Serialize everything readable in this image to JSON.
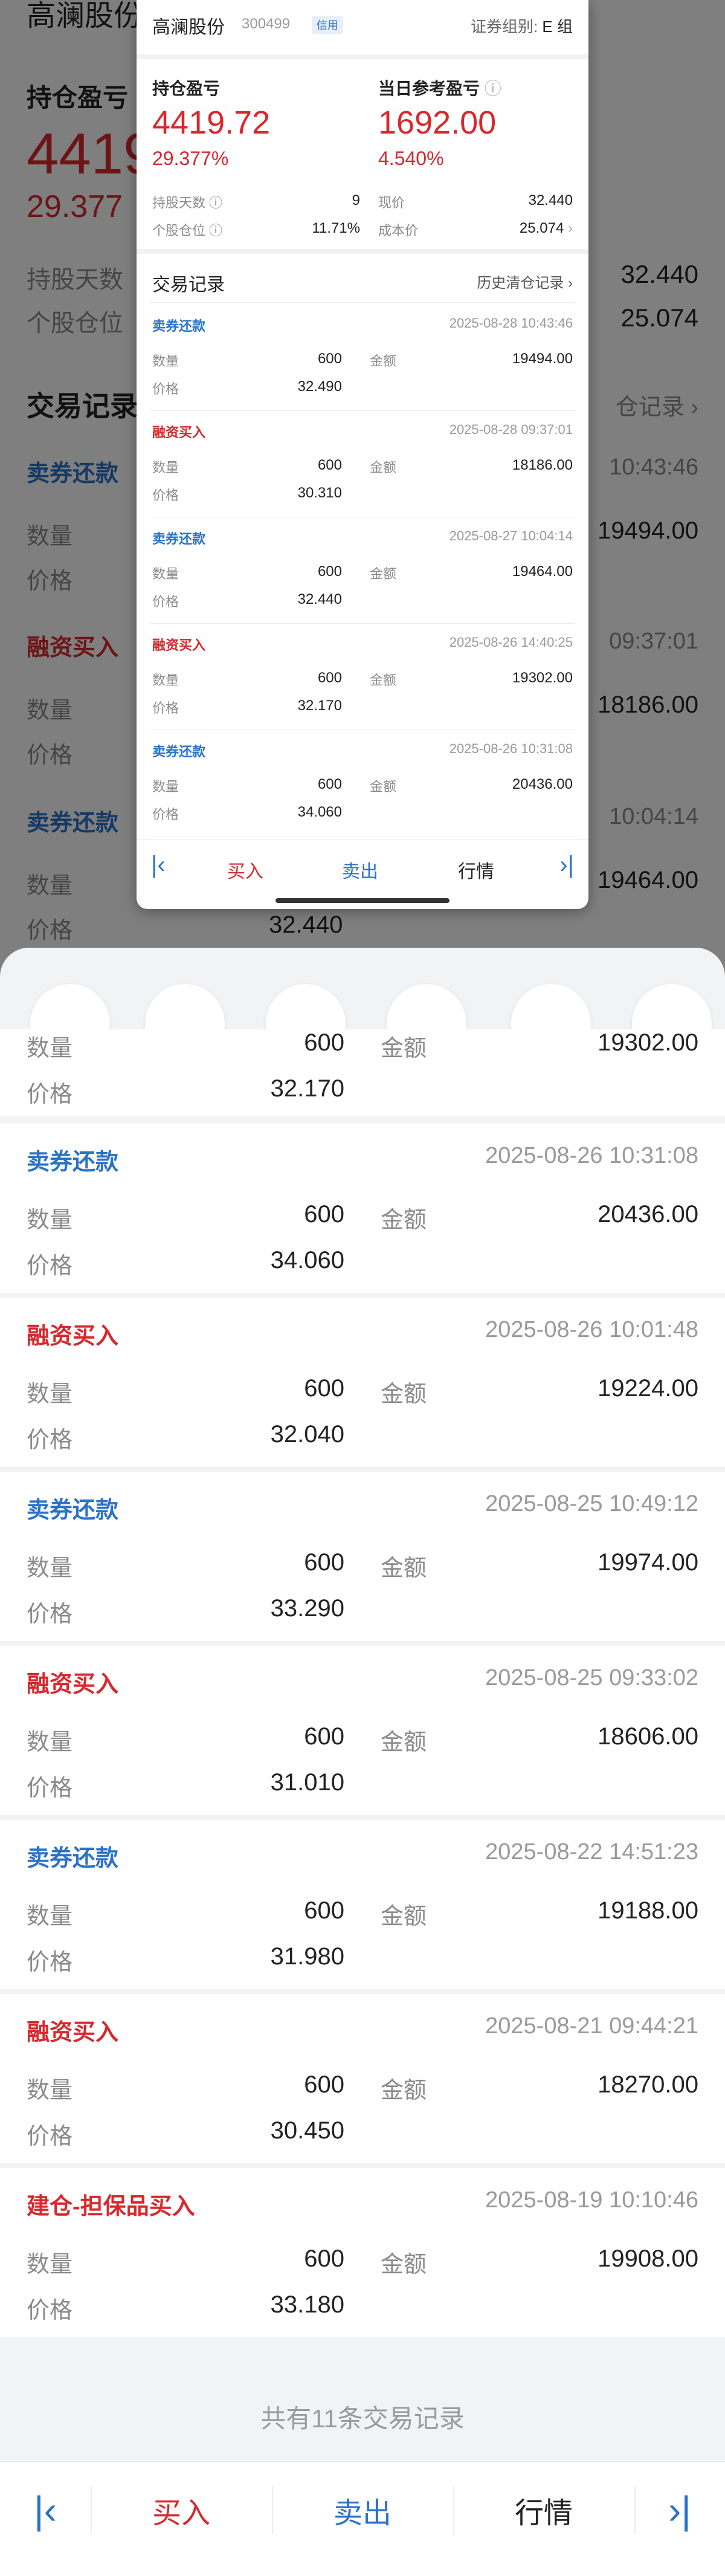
{
  "background": {
    "header_name": "高澜股份",
    "section_label": "持仓盈亏",
    "big_value": "4419",
    "big_pct": "29.377",
    "row1_label": "持股天数",
    "row1_value": "32.440",
    "row2_label": "个股仓位",
    "row2_value": "25.074",
    "trade_title": "交易记录",
    "history_link": "仓记录",
    "records": [
      {
        "type": "卖券还款",
        "time_frag": "10:43:46",
        "qty_label": "数量",
        "price_label": "价格",
        "amount": "19494.00"
      },
      {
        "type": "融资买入",
        "time_frag": "09:37:01",
        "qty_label": "数量",
        "price_label": "价格",
        "amount": "18186.00"
      },
      {
        "type": "卖券还款",
        "time_frag": "10:04:14",
        "qty_label": "数量",
        "price_label": "价格",
        "amount": "19464.00",
        "price": "32.440"
      }
    ]
  },
  "thumbnail": {
    "stock_name": "高澜股份",
    "stock_code": "300499",
    "credit_badge": "信用",
    "group_label": "证券组别:",
    "group_value": "E 组",
    "position_pl_label": "持仓盈亏",
    "position_pl_value": "4419.72",
    "position_pl_pct": "29.377%",
    "daily_pl_label": "当日参考盈亏",
    "daily_pl_value": "1692.00",
    "daily_pl_pct": "4.540%",
    "hold_days_label": "持股天数",
    "hold_days_value": "9",
    "current_price_label": "现价",
    "current_price_value": "32.440",
    "position_ratio_label": "个股仓位",
    "position_ratio_value": "11.71%",
    "cost_label": "成本价",
    "cost_value": "25.074",
    "trade_title": "交易记录",
    "history_link": "历史清仓记录",
    "records": [
      {
        "type": "卖券还款",
        "time": "2025-08-28 10:43:46",
        "qty": "600",
        "amount": "19494.00",
        "price": "32.490"
      },
      {
        "type": "融资买入",
        "time": "2025-08-28 09:37:01",
        "qty": "600",
        "amount": "18186.00",
        "price": "30.310"
      },
      {
        "type": "卖券还款",
        "time": "2025-08-27 10:04:14",
        "qty": "600",
        "amount": "19464.00",
        "price": "32.440"
      },
      {
        "type": "融资买入",
        "time": "2025-08-26 14:40:25",
        "qty": "600",
        "amount": "19302.00",
        "price": "32.170"
      },
      {
        "type": "卖券还款",
        "time": "2025-08-26 10:31:08",
        "qty": "600",
        "amount": "20436.00",
        "price": "34.060"
      }
    ],
    "qty_label": "数量",
    "amount_label": "金额",
    "price_label": "价格",
    "toolbar": {
      "buy": "买入",
      "sell": "卖出",
      "market": "行情"
    }
  },
  "sheet": {
    "partial_record": {
      "qty_label": "数量",
      "qty": "600",
      "amount_label": "金额",
      "amount": "19302.00",
      "price_label": "价格",
      "price": "32.170"
    },
    "records": [
      {
        "type": "卖券还款",
        "color": "#2a72c8",
        "time": "2025-08-26 10:31:08",
        "qty_label": "数量",
        "qty": "600",
        "amount_label": "金额",
        "amount": "20436.00",
        "price_label": "价格",
        "price": "34.060"
      },
      {
        "type": "融资买入",
        "color": "#d8282d",
        "time": "2025-08-26 10:01:48",
        "qty_label": "数量",
        "qty": "600",
        "amount_label": "金额",
        "amount": "19224.00",
        "price_label": "价格",
        "price": "32.040"
      },
      {
        "type": "卖券还款",
        "color": "#2a72c8",
        "time": "2025-08-25 10:49:12",
        "qty_label": "数量",
        "qty": "600",
        "amount_label": "金额",
        "amount": "19974.00",
        "price_label": "价格",
        "price": "33.290"
      },
      {
        "type": "融资买入",
        "color": "#d8282d",
        "time": "2025-08-25 09:33:02",
        "qty_label": "数量",
        "qty": "600",
        "amount_label": "金额",
        "amount": "18606.00",
        "price_label": "价格",
        "price": "31.010"
      },
      {
        "type": "卖券还款",
        "color": "#2a72c8",
        "time": "2025-08-22 14:51:23",
        "qty_label": "数量",
        "qty": "600",
        "amount_label": "金额",
        "amount": "19188.00",
        "price_label": "价格",
        "price": "31.980"
      },
      {
        "type": "融资买入",
        "color": "#d8282d",
        "time": "2025-08-21 09:44:21",
        "qty_label": "数量",
        "qty": "600",
        "amount_label": "金额",
        "amount": "18270.00",
        "price_label": "价格",
        "price": "30.450"
      },
      {
        "type": "建仓-担保品买入",
        "color": "#d8282d",
        "time": "2025-08-19 10:10:46",
        "qty_label": "数量",
        "qty": "600",
        "amount_label": "金额",
        "amount": "19908.00",
        "price_label": "价格",
        "price": "33.180"
      }
    ],
    "summary": "共有11条交易记录",
    "toolbar": {
      "buy": "买入",
      "sell": "卖出",
      "market": "行情"
    },
    "colors": {
      "buy_red": "#d8282d",
      "sell_blue": "#2a72c8"
    }
  }
}
